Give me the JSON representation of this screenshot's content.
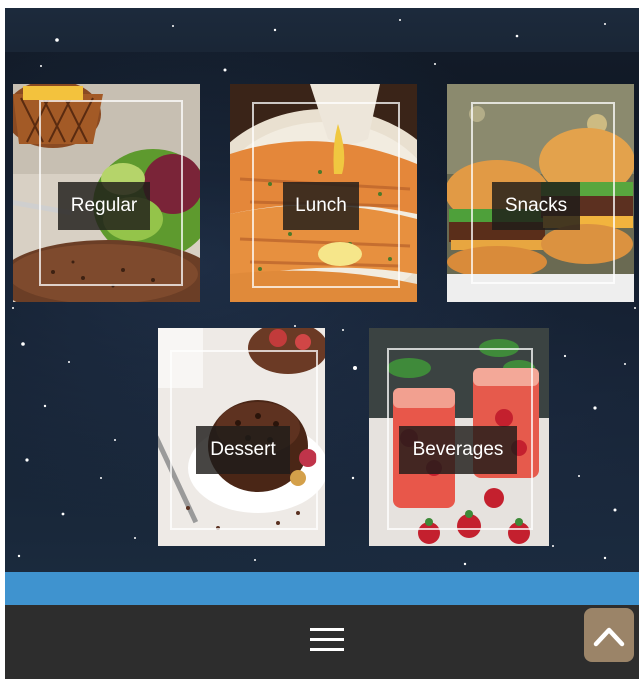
{
  "menu": {
    "categories": [
      {
        "label": "Regular",
        "photo": "salad-steak"
      },
      {
        "label": "Lunch",
        "photo": "grilled-fish"
      },
      {
        "label": "Snacks",
        "photo": "burgers"
      },
      {
        "label": "Dessert",
        "photo": "chocolate-cake"
      },
      {
        "label": "Beverages",
        "photo": "strawberry-drinks"
      }
    ]
  },
  "footer": {
    "menu_icon": "hamburger-menu-icon",
    "top_icon": "chevron-up-icon"
  },
  "colors": {
    "background": "#0f1722",
    "accent_bar": "#3f93cf",
    "footer": "#2d2d2d",
    "scroll_top_button": "#9b8468"
  }
}
